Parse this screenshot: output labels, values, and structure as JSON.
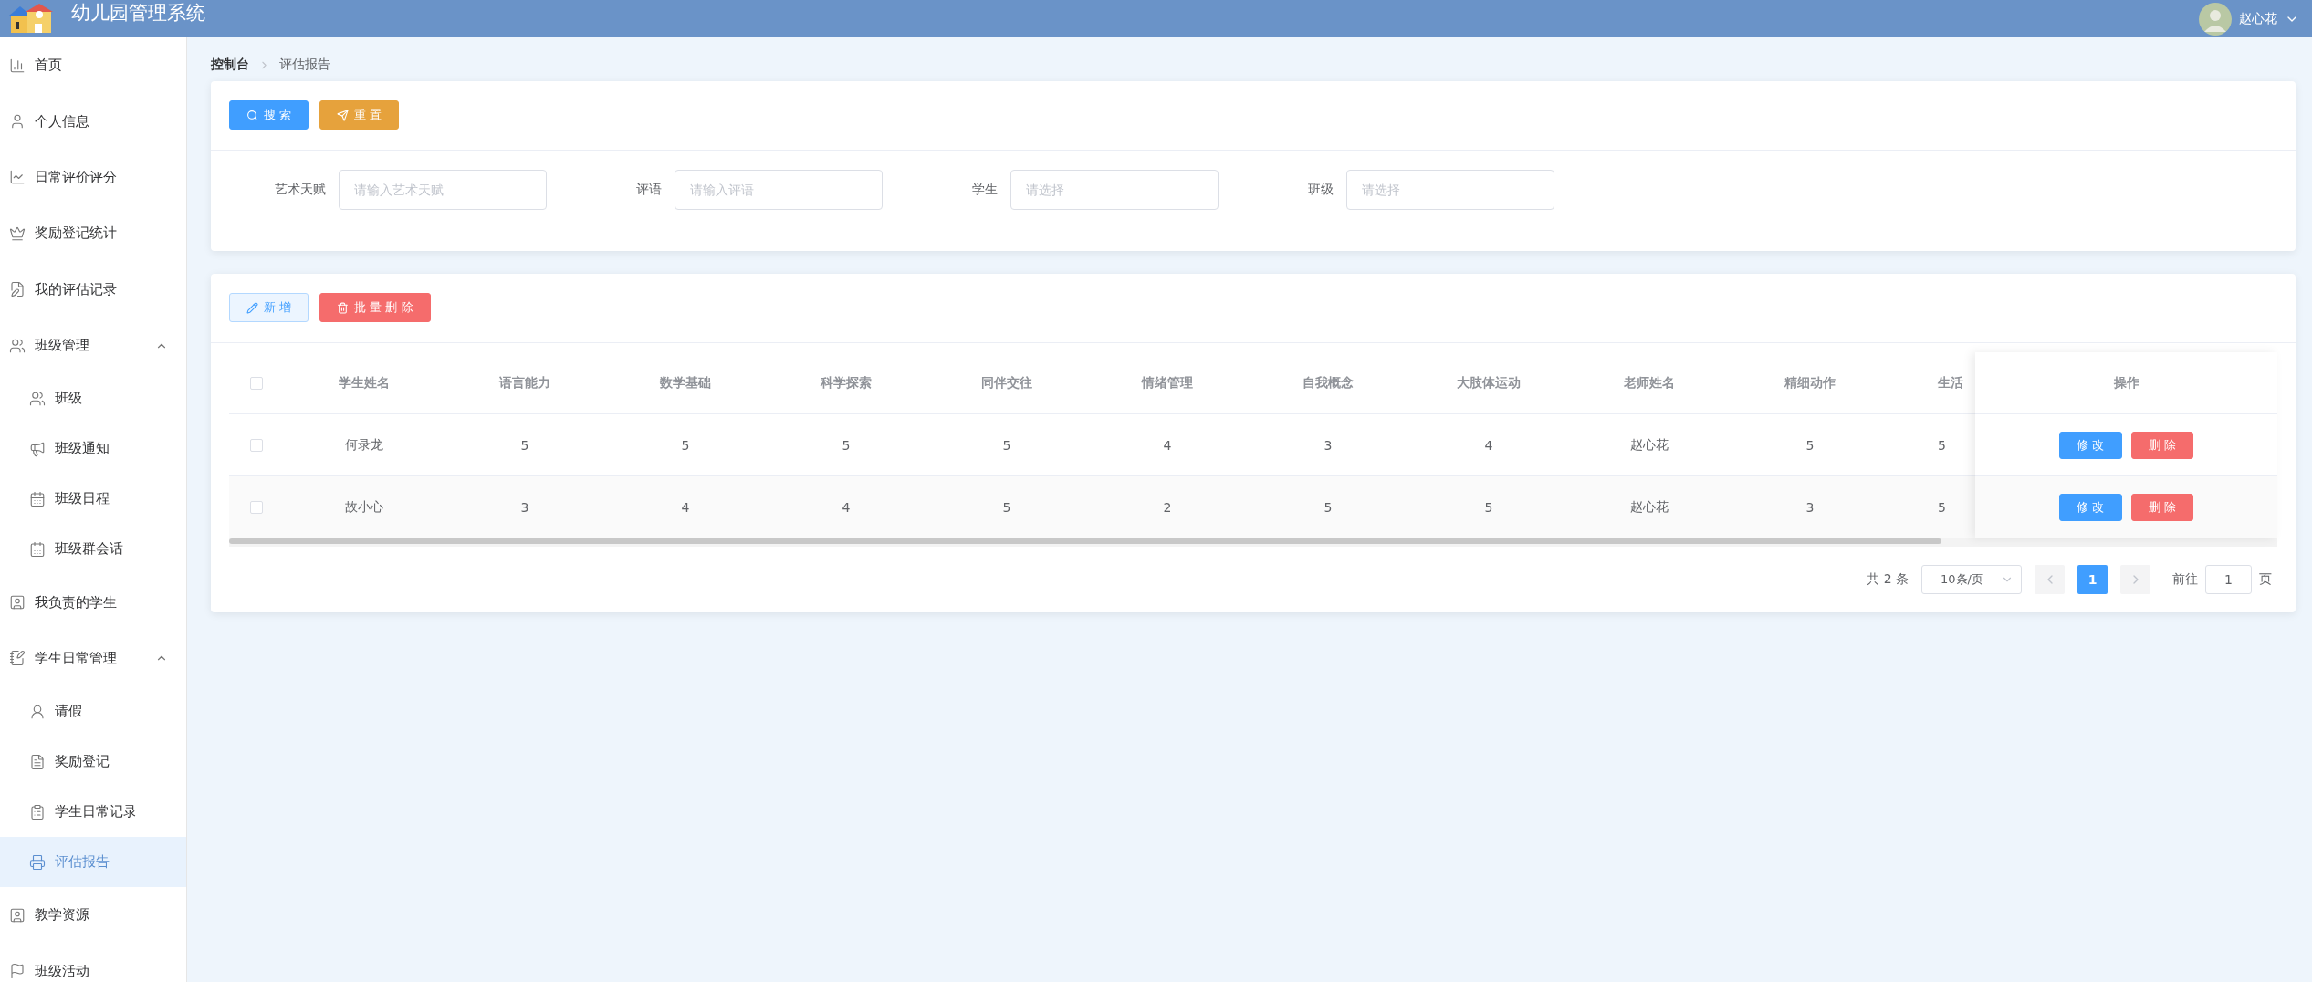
{
  "header": {
    "title": "幼儿园管理系统",
    "user": "赵心花"
  },
  "sidebar": {
    "items": [
      {
        "label": "首页",
        "selected": false
      },
      {
        "label": "个人信息",
        "selected": false
      },
      {
        "label": "日常评价评分",
        "selected": false
      },
      {
        "label": "奖励登记统计",
        "selected": false
      },
      {
        "label": "我的评估记录",
        "selected": false
      },
      {
        "label": "班级管理",
        "selected": false,
        "expanded": true,
        "children": [
          {
            "label": "班级",
            "selected": false
          },
          {
            "label": "班级通知",
            "selected": false
          },
          {
            "label": "班级日程",
            "selected": false
          },
          {
            "label": "班级群会话",
            "selected": false
          }
        ]
      },
      {
        "label": "我负责的学生",
        "selected": false
      },
      {
        "label": "学生日常管理",
        "selected": false,
        "expanded": true,
        "children": [
          {
            "label": "请假",
            "selected": false
          },
          {
            "label": "奖励登记",
            "selected": false
          },
          {
            "label": "学生日常记录",
            "selected": false
          },
          {
            "label": "评估报告",
            "selected": true
          }
        ]
      },
      {
        "label": "教学资源",
        "selected": false
      },
      {
        "label": "班级活动",
        "selected": false
      }
    ]
  },
  "breadcrumb": [
    "控制台",
    "评估报告"
  ],
  "search": {
    "buttons": [
      {
        "label": "搜 索",
        "kind": "search"
      },
      {
        "label": "重 置",
        "kind": "reset"
      }
    ],
    "fields": [
      {
        "label": "艺术天赋",
        "placeholder": "请输入艺术天赋"
      },
      {
        "label": "评语",
        "placeholder": "请输入评语"
      },
      {
        "label": "学生",
        "placeholder": "请选择"
      },
      {
        "label": "班级",
        "placeholder": "请选择"
      }
    ]
  },
  "toolbar": [
    {
      "label": "新 增",
      "kind": "add"
    },
    {
      "label": "批 量 删 除",
      "kind": "delete"
    }
  ],
  "table": {
    "select_all": {
      "checked": false
    },
    "columns": [
      "学生姓名",
      "语言能力",
      "数学基础",
      "科学探索",
      "同伴交往",
      "情绪管理",
      "自我概念",
      "大肢体运动",
      "老师姓名",
      "精细动作",
      "生活"
    ],
    "action_column": "操作",
    "rows": [
      {
        "checked": false,
        "cells": [
          "何录龙",
          "5",
          "5",
          "5",
          "5",
          "4",
          "3",
          "4",
          "赵心花",
          "5",
          "5"
        ],
        "actions": [
          "修 改",
          "删 除"
        ]
      },
      {
        "checked": false,
        "cells": [
          "故小心",
          "3",
          "4",
          "4",
          "5",
          "2",
          "5",
          "5",
          "赵心花",
          "3",
          "5"
        ],
        "actions": [
          "修 改",
          "删 除"
        ]
      }
    ]
  },
  "pagination": {
    "total": "共 2 条",
    "page_size": "10条/页",
    "pages": [
      {
        "label": "1",
        "selected": true
      }
    ],
    "goto_label": "前往",
    "goto_value": "1",
    "page_suffix": "页"
  }
}
